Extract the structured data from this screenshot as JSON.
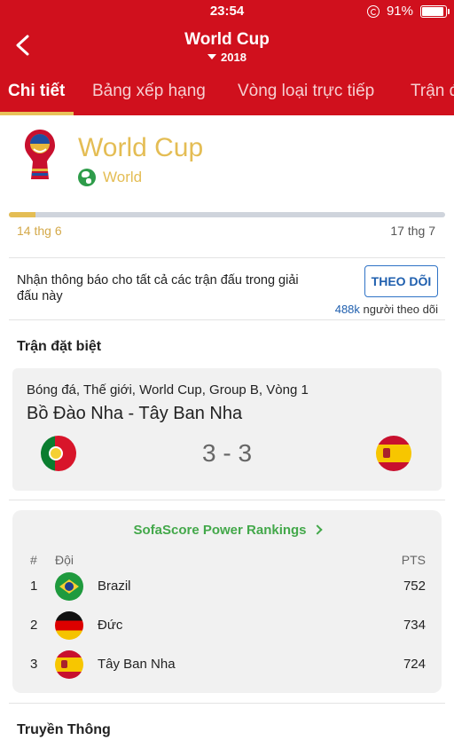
{
  "status_bar": {
    "time": "23:54",
    "battery": "91%",
    "battery_level": 0.91
  },
  "header": {
    "title": "World Cup",
    "season": "2018"
  },
  "tabs": [
    {
      "label": "Chi tiết",
      "active": true
    },
    {
      "label": "Bảng xếp hạng",
      "active": false
    },
    {
      "label": "Vòng loại trực tiếp",
      "active": false
    },
    {
      "label": "Trận đ",
      "active": false
    }
  ],
  "league": {
    "name": "World Cup",
    "region": "World"
  },
  "season_progress": {
    "start": "14 thg 6",
    "end": "17 thg 7",
    "fraction": 0.06
  },
  "follow": {
    "message": "Nhận thông báo cho tất cả các trận đấu trong giải đấu này",
    "button": "THEO DÕI",
    "count": "488k",
    "count_suffix": "người theo dõi"
  },
  "special_match": {
    "section_title": "Trận đặt biệt",
    "meta": "Bóng đá, Thế giới, World Cup, Group B, Vòng 1",
    "teams": "Bồ Đào Nha - Tây Ban Nha",
    "score": "3 - 3"
  },
  "power_rankings": {
    "title": "SofaScore Power Rankings",
    "col_pos": "#",
    "col_team": "Đội",
    "col_pts": "PTS",
    "rows": [
      {
        "pos": "1",
        "team": "Brazil",
        "pts": "752"
      },
      {
        "pos": "2",
        "team": "Đức",
        "pts": "734"
      },
      {
        "pos": "3",
        "team": "Tây Ban Nha",
        "pts": "724"
      }
    ]
  },
  "media": {
    "section_title": "Truyền Thông"
  },
  "colors": {
    "brand_red": "#d0101d",
    "gold": "#e4bd54",
    "link_blue": "#1f5fae",
    "green": "#43a84a"
  }
}
